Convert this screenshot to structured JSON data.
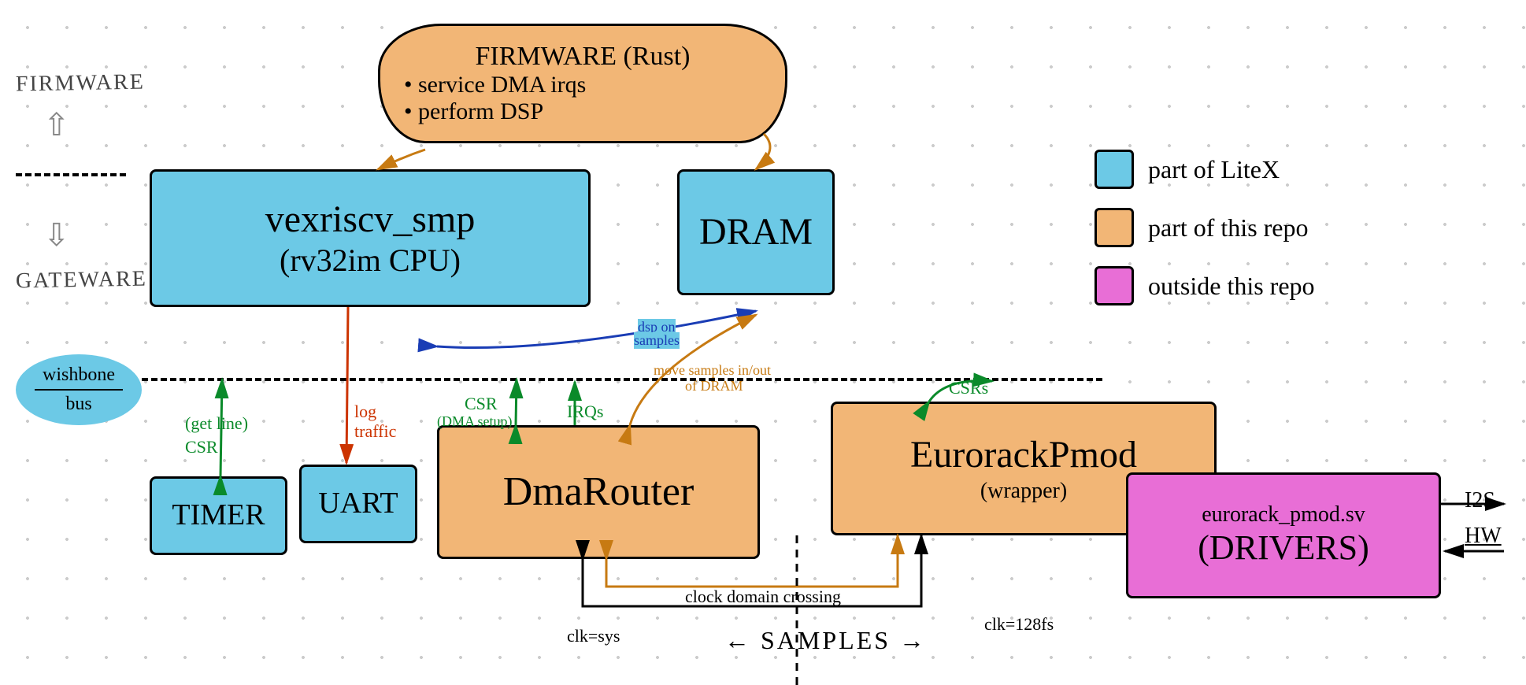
{
  "side_labels": {
    "firmware": "FIRMWARE",
    "gateware": "GATEWARE"
  },
  "cloud": {
    "title": "FIRMWARE (Rust)",
    "bullet1": "• service DMA irqs",
    "bullet2": "• perform DSP"
  },
  "boxes": {
    "cpu_line1": "vexriscv_smp",
    "cpu_line2": "(rv32im CPU)",
    "dram": "DRAM",
    "timer": "TIMER",
    "uart": "UART",
    "dmarouter": "DmaRouter",
    "eurorack_line1": "EurorackPmod",
    "eurorack_line2": "(wrapper)",
    "drivers_line1": "eurorack_pmod.sv",
    "drivers_line2": "(DRIVERS)"
  },
  "bus": {
    "wishbone_line1": "wishbone",
    "wishbone_line2": "bus"
  },
  "annotations": {
    "get_line": "(get line)",
    "csr_timer": "CSR",
    "log_traffic_line1": "log",
    "log_traffic_line2": "traffic",
    "csr_dma_line1": "CSR",
    "csr_dma_line2": "(DMA setup)",
    "irqs": "IRQs",
    "dsp_on_line1": "dsp on",
    "dsp_on_line2": "samples",
    "move_samples_line1": "move samples in/out",
    "move_samples_line2": "of DRAM",
    "csrs": "CSRs",
    "clock_crossing": "clock domain crossing",
    "clk_sys": "clk=sys",
    "clk_128fs": "clk=128fs",
    "samples": "SAMPLES",
    "i2s": "I2S",
    "hw": "HW"
  },
  "legend": {
    "litex": "part of LiteX",
    "this_repo": "part of this repo",
    "outside": "outside this repo"
  }
}
